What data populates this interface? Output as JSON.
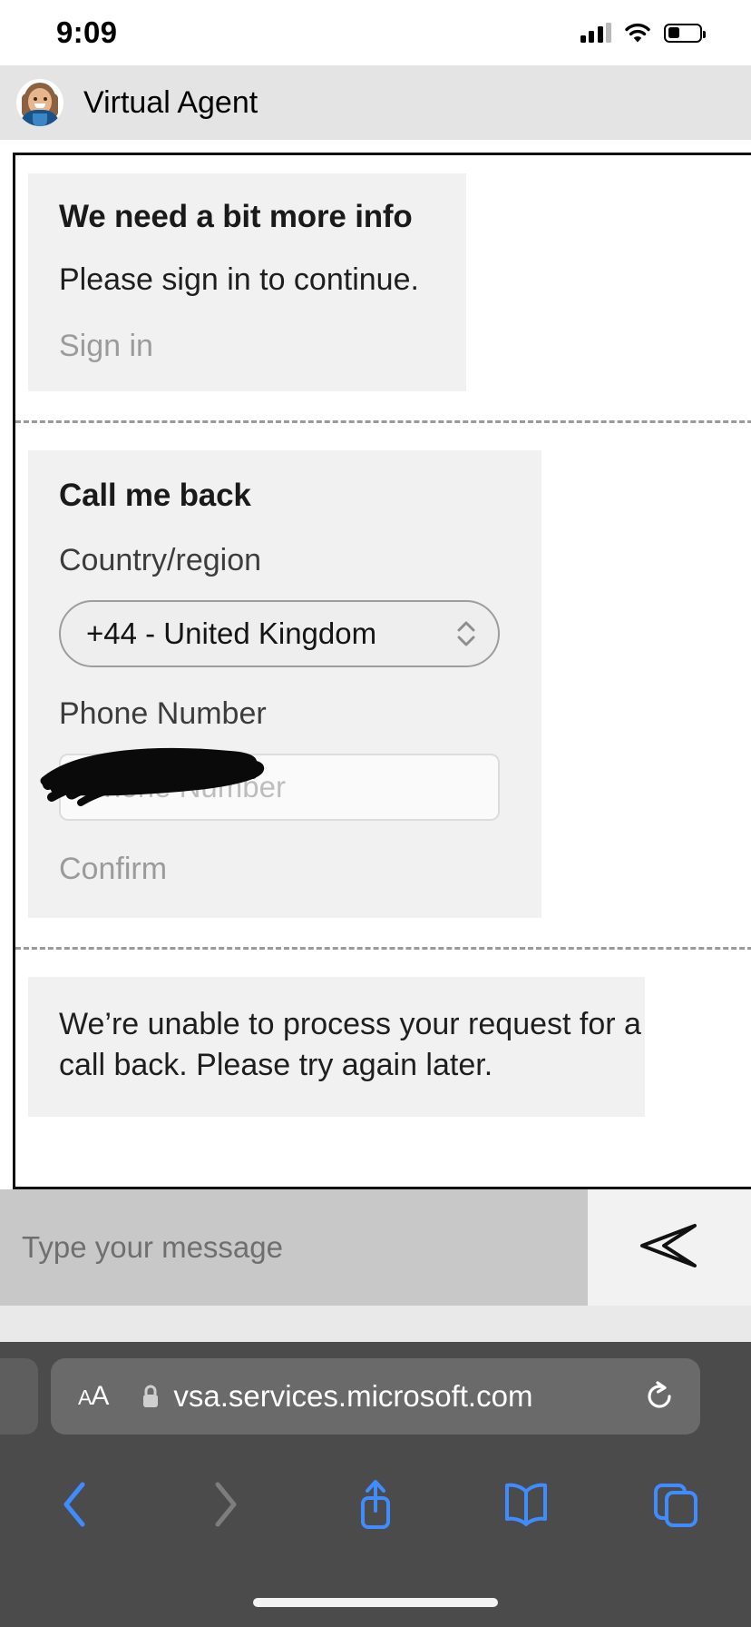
{
  "status_bar": {
    "time": "9:09",
    "icons": [
      "cellular-signal-icon",
      "wifi-icon",
      "battery-icon"
    ]
  },
  "chat_header": {
    "avatar_name": "agent-avatar",
    "title": "Virtual Agent"
  },
  "conversation": {
    "sign_in_card": {
      "heading": "We need a bit more info",
      "body": "Please sign in to continue.",
      "action": "Sign in"
    },
    "call_back_card": {
      "heading": "Call me back",
      "country_label": "Country/region",
      "country_value": "+44 - United Kingdom",
      "phone_label": "Phone Number",
      "phone_placeholder": "Phone Number",
      "phone_value": "",
      "redaction": "scribble-redaction",
      "action": "Confirm"
    },
    "error_card": {
      "text": "We’re unable to process your request for a call back. Please try again later."
    }
  },
  "composer": {
    "placeholder": "Type your message",
    "value": "",
    "send_icon": "send-paper-plane-icon"
  },
  "browser": {
    "text_size_label": "ᴀA",
    "lock_icon": "lock-icon",
    "url": "vsa.services.microsoft.com",
    "reload_icon": "reload-icon",
    "toolbar": {
      "back_icon": "chevron-left-icon",
      "forward_icon": "chevron-right-icon",
      "share_icon": "share-icon",
      "bookmarks_icon": "book-icon",
      "tabs_icon": "tabs-icon"
    },
    "colors": {
      "chrome": "#4b4b4b",
      "pill": "#6a6a6a",
      "accent": "#3f8cff"
    }
  }
}
